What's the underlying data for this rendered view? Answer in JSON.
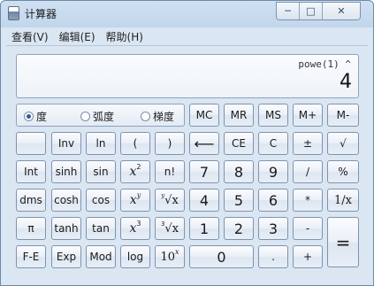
{
  "window": {
    "title": "计算器"
  },
  "window_controls": {
    "minimize": "─",
    "maximize": "□",
    "close": "✕"
  },
  "menu": [
    "查看(V)",
    "编辑(E)",
    "帮助(H)"
  ],
  "display": {
    "expression": "powe(1) ^",
    "value": "4"
  },
  "angle_modes": {
    "degree": "度",
    "radian": "弧度",
    "gradian": "梯度",
    "selected": "度"
  },
  "buttons": {
    "mc": "MC",
    "mr": "MR",
    "ms": "MS",
    "mplus": "M+",
    "mminus": "M-",
    "inv": "Inv",
    "ln": "ln",
    "lparen": "(",
    "rparen": ")",
    "backspace": "⟵",
    "ce": "CE",
    "c": "C",
    "plusminus": "±",
    "sqrt": "√",
    "int": "Int",
    "sinh": "sinh",
    "sin": "sin",
    "x2_base": "x",
    "x2_exp": "2",
    "factorial": "n!",
    "d7": "7",
    "d8": "8",
    "d9": "9",
    "divide": "/",
    "percent": "%",
    "dms": "dms",
    "cosh": "cosh",
    "cos": "cos",
    "xy_base": "x",
    "xy_exp": "y",
    "yroot_x_index": "y",
    "yroot_x_sym": "√x",
    "d4": "4",
    "d5": "5",
    "d6": "6",
    "multiply": "*",
    "reciprocal": "1/x",
    "pi": "π",
    "tanh": "tanh",
    "tan": "tan",
    "x3_base": "x",
    "x3_exp": "3",
    "cuberoot_index": "3",
    "cuberoot_sym": "√x",
    "d1": "1",
    "d2": "2",
    "d3": "3",
    "minus": "-",
    "equals": "=",
    "fe": "F-E",
    "exp": "Exp",
    "mod": "Mod",
    "log": "log",
    "tenx_base": "10",
    "tenx_exp": "x",
    "d0": "0",
    "decimal": ".",
    "plus": "+"
  }
}
